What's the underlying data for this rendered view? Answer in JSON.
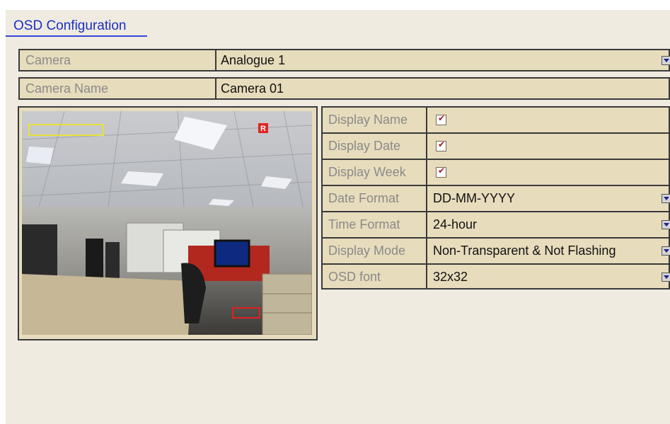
{
  "page": {
    "title": "OSD Configuration"
  },
  "camera": {
    "label": "Camera",
    "value": "Analogue 1"
  },
  "camera_name": {
    "label": "Camera Name",
    "value": "Camera 01"
  },
  "preview": {
    "overlay_badge": "R",
    "name_box_color": "#e8e23a",
    "date_box_color": "#e02020"
  },
  "settings": {
    "display_name": {
      "label": "Display Name",
      "checked": true
    },
    "display_date": {
      "label": "Display Date",
      "checked": true
    },
    "display_week": {
      "label": "Display Week",
      "checked": true
    },
    "date_format": {
      "label": "Date Format",
      "value": "DD-MM-YYYY"
    },
    "time_format": {
      "label": "Time Format",
      "value": "24-hour"
    },
    "display_mode": {
      "label": "Display Mode",
      "value": "Non-Transparent & Not Flashing"
    },
    "osd_font": {
      "label": "OSD font",
      "value": "32x32"
    }
  }
}
